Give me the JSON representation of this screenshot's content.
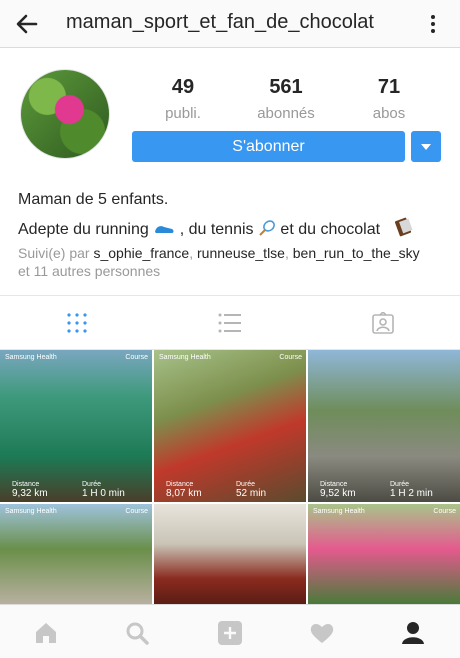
{
  "header": {
    "username": "maman_sport_et_fan_de_chocolat"
  },
  "profile": {
    "stats": [
      {
        "value": "49",
        "label": "publi."
      },
      {
        "value": "561",
        "label": "abonnés"
      },
      {
        "value": "71",
        "label": "abos"
      }
    ],
    "follow_label": "S'abonner",
    "bio_line1": "Maman de 5 enfants.",
    "bio_line2_a": "Adepte du running",
    "bio_line2_b": ", du tennis",
    "bio_line2_c": " et du chocolat",
    "followed_prefix": "Suivi(e) par",
    "followed_users": [
      "s_ophie_france",
      "runneuse_tlse",
      "ben_run_to_the_sky"
    ],
    "followed_suffix": "et 11 autres personnes"
  },
  "tabs": [
    "grid-icon",
    "list-icon",
    "tagged-icon"
  ],
  "posts": [
    {
      "brand": "Samsung Health",
      "tag": "Course",
      "dist_label": "Distance",
      "dist": "9,32 km",
      "dur_label": "Durée",
      "dur": "1 H 0 min"
    },
    {
      "brand": "Samsung Health",
      "tag": "Course",
      "dist_label": "Distance",
      "dist": "8,07 km",
      "dur_label": "Durée",
      "dur": "52 min"
    },
    {
      "brand": "",
      "tag": "",
      "dist_label": "Distance",
      "dist": "9,52 km",
      "dur_label": "Durée",
      "dur": "1 H 2 min"
    },
    {
      "brand": "Samsung Health",
      "tag": "Course",
      "dist_label": "",
      "dist": "",
      "dur_label": "",
      "dur": ""
    },
    {
      "brand": "",
      "tag": "",
      "dist_label": "",
      "dist": "",
      "dur_label": "",
      "dur": ""
    },
    {
      "brand": "Samsung Health",
      "tag": "Course",
      "dist_label": "",
      "dist": "",
      "dur_label": "",
      "dur": ""
    }
  ],
  "nav": [
    "home-icon",
    "search-icon",
    "add-icon",
    "heart-icon",
    "profile-icon"
  ],
  "colors": {
    "accent": "#3897f0",
    "muted": "#999999",
    "text": "#262626"
  }
}
